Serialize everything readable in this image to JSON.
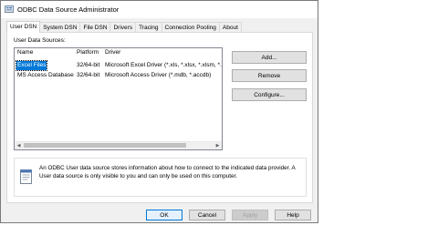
{
  "window": {
    "title": "ODBC Data Source Administrator"
  },
  "tabs": [
    {
      "label": "User DSN",
      "active": true
    },
    {
      "label": "System DSN",
      "active": false
    },
    {
      "label": "File DSN",
      "active": false
    },
    {
      "label": "Drivers",
      "active": false
    },
    {
      "label": "Tracing",
      "active": false
    },
    {
      "label": "Connection Pooling",
      "active": false
    },
    {
      "label": "About",
      "active": false
    }
  ],
  "panel": {
    "section_label": "User Data Sources:",
    "columns": {
      "name": "Name",
      "platform": "Platform",
      "driver": "Driver"
    },
    "rows": [
      {
        "name": "Excel Files",
        "platform": "32/64-bit",
        "driver": "Microsoft Excel Driver (*.xls, *.xlsx, *.xlsm, *.xlsb",
        "selected": true
      },
      {
        "name": "MS Access Database",
        "platform": "32/64-bit",
        "driver": "Microsoft Access Driver (*.mdb, *.accdb)",
        "selected": false
      }
    ],
    "buttons": {
      "add": "Add...",
      "remove": "Remove",
      "configure": "Configure..."
    },
    "info_text": "An ODBC User data source stores information about how to connect to the indicated data provider.  A User data source is only visible to you and can only be used on this computer."
  },
  "footer": {
    "ok": "OK",
    "cancel": "Cancel",
    "apply": "Apply",
    "help": "Help"
  },
  "colors": {
    "selection": "#0078d7",
    "window_bg": "#f0f0f0",
    "default_button_border": "#0078d7"
  },
  "icons": {
    "app": "odbc-admin-icon",
    "info": "document-info-icon"
  }
}
